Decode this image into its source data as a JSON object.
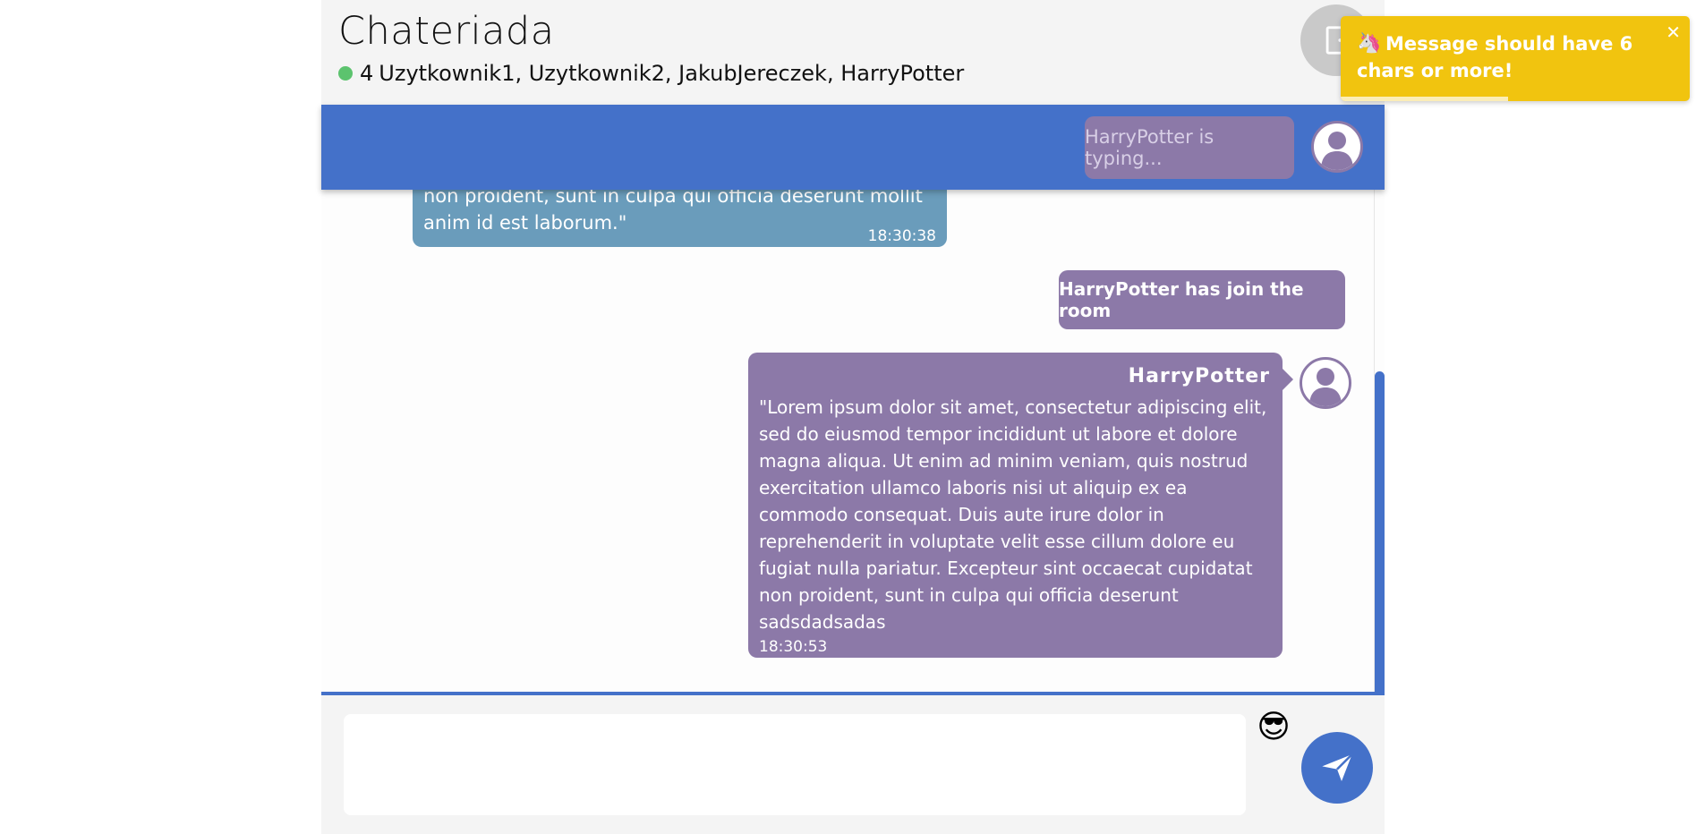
{
  "header": {
    "title": "Chateriada",
    "users_count": "4",
    "users_list": "Uzytkownik1, Uzytkownik2, JakubJereczek, HarryPotter"
  },
  "typing": {
    "text": "HarryPotter is typing..."
  },
  "messages": [
    {
      "type": "user",
      "text": "non proident, sunt in culpa qui officia deserunt mollit anim id est laborum.\"",
      "time": "18:30:38"
    },
    {
      "type": "system",
      "text": "HarryPotter has join the room"
    },
    {
      "type": "user",
      "author": "HarryPotter",
      "text": "\"Lorem ipsum dolor sit amet, consectetur adipiscing elit, sed do eiusmod tempor incididunt ut labore et dolore magna aliqua. Ut enim ad minim veniam, quis nostrud exercitation ullamco laboris nisi ut aliquip ex ea commodo consequat. Duis aute irure dolor in reprehenderit in voluptate velit esse cillum dolore eu fugiat nulla pariatur. Excepteur sint occaecat cupidatat non proident, sunt in culpa qui officia deserunt sadsdadsadas",
      "time": "18:30:53"
    }
  ],
  "composer": {
    "value": "",
    "emoji": "😎"
  },
  "toast": {
    "icon": "🦄",
    "message": "Message should have 6 chars or more!",
    "close": "✕",
    "progress": 0.48
  },
  "colors": {
    "accent": "#4471c9",
    "purple": "#8c79a8",
    "blue_message": "#6a9cbb",
    "online": "#5cc36e",
    "toast": "#f1c40f"
  },
  "icons": {
    "exit": "door-exit-icon",
    "avatar": "user-avatar-icon",
    "send": "paper-plane-icon"
  }
}
